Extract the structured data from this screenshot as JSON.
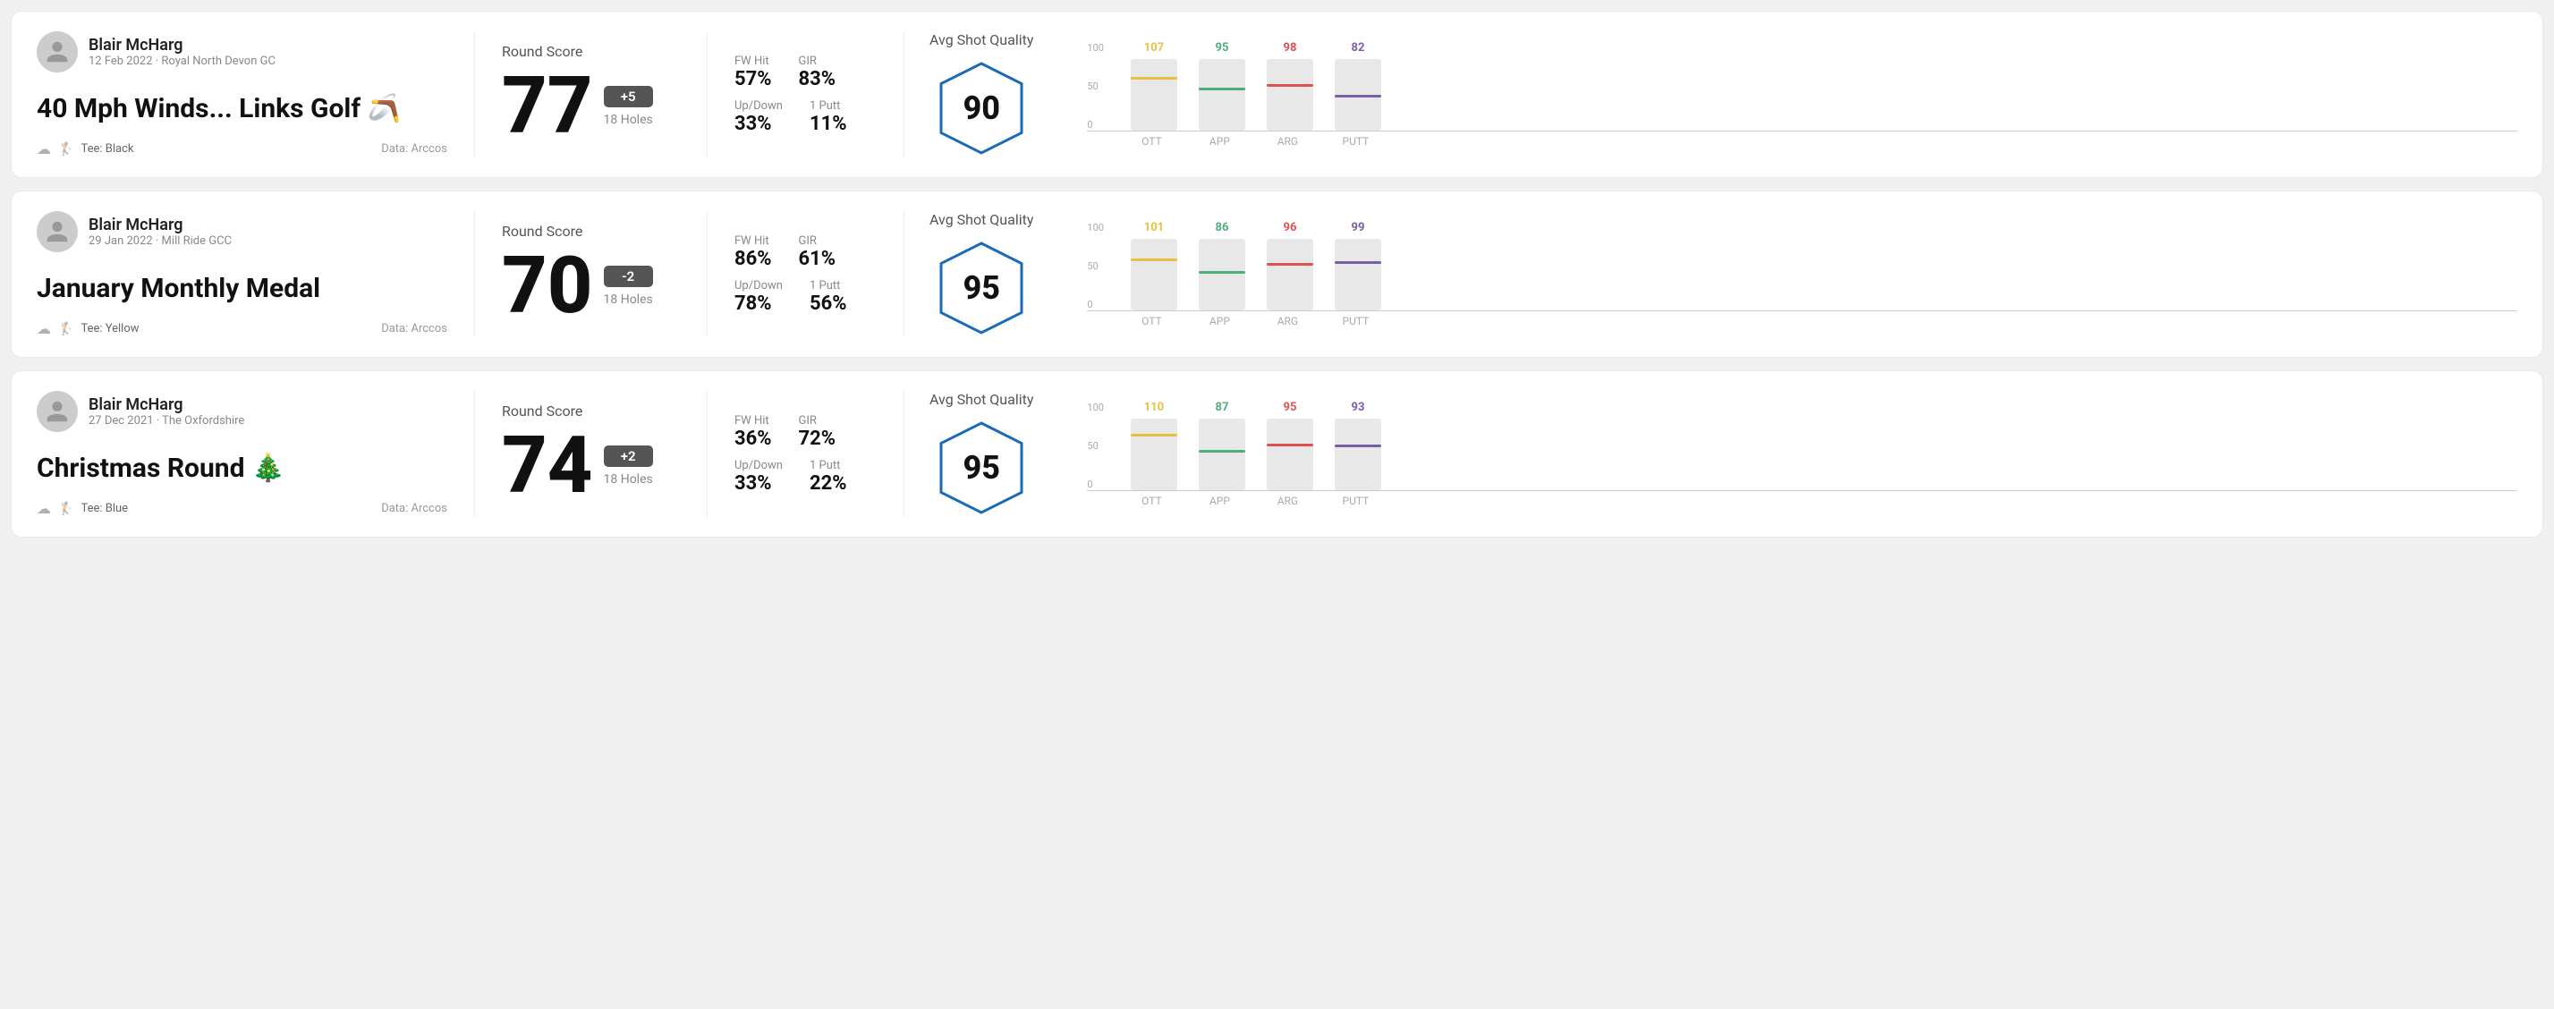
{
  "rounds": [
    {
      "id": "round1",
      "user": {
        "name": "Blair McHarg",
        "meta": "12 Feb 2022 · Royal North Devon GC"
      },
      "title": "40 Mph Winds... Links Golf 🪃",
      "tee": "Black",
      "data_source": "Data: Arccos",
      "score": {
        "value": "77",
        "badge": "+5",
        "holes": "18 Holes"
      },
      "stats": [
        {
          "label": "FW Hit",
          "value": "57%"
        },
        {
          "label": "GIR",
          "value": "83%"
        },
        {
          "label": "Up/Down",
          "value": "33%"
        },
        {
          "label": "1 Putt",
          "value": "11%"
        }
      ],
      "quality": {
        "label": "Avg Shot Quality",
        "score": "90"
      },
      "chart": {
        "bars": [
          {
            "label": "OTT",
            "value": 107,
            "color": "#e8c040",
            "pct": 75
          },
          {
            "label": "APP",
            "value": 95,
            "color": "#4caf78",
            "pct": 60
          },
          {
            "label": "ARG",
            "value": 98,
            "color": "#e05050",
            "pct": 65
          },
          {
            "label": "PUTT",
            "value": 82,
            "color": "#7b5ea7",
            "pct": 50
          }
        ]
      }
    },
    {
      "id": "round2",
      "user": {
        "name": "Blair McHarg",
        "meta": "29 Jan 2022 · Mill Ride GCC"
      },
      "title": "January Monthly Medal",
      "tee": "Yellow",
      "data_source": "Data: Arccos",
      "score": {
        "value": "70",
        "badge": "-2",
        "holes": "18 Holes"
      },
      "stats": [
        {
          "label": "FW Hit",
          "value": "86%"
        },
        {
          "label": "GIR",
          "value": "61%"
        },
        {
          "label": "Up/Down",
          "value": "78%"
        },
        {
          "label": "1 Putt",
          "value": "56%"
        }
      ],
      "quality": {
        "label": "Avg Shot Quality",
        "score": "95"
      },
      "chart": {
        "bars": [
          {
            "label": "OTT",
            "value": 101,
            "color": "#e8c040",
            "pct": 72
          },
          {
            "label": "APP",
            "value": 86,
            "color": "#4caf78",
            "pct": 55
          },
          {
            "label": "ARG",
            "value": 96,
            "color": "#e05050",
            "pct": 66
          },
          {
            "label": "PUTT",
            "value": 99,
            "color": "#7b5ea7",
            "pct": 68
          }
        ]
      }
    },
    {
      "id": "round3",
      "user": {
        "name": "Blair McHarg",
        "meta": "27 Dec 2021 · The Oxfordshire"
      },
      "title": "Christmas Round 🎄",
      "tee": "Blue",
      "data_source": "Data: Arccos",
      "score": {
        "value": "74",
        "badge": "+2",
        "holes": "18 Holes"
      },
      "stats": [
        {
          "label": "FW Hit",
          "value": "36%"
        },
        {
          "label": "GIR",
          "value": "72%"
        },
        {
          "label": "Up/Down",
          "value": "33%"
        },
        {
          "label": "1 Putt",
          "value": "22%"
        }
      ],
      "quality": {
        "label": "Avg Shot Quality",
        "score": "95"
      },
      "chart": {
        "bars": [
          {
            "label": "OTT",
            "value": 110,
            "color": "#e8c040",
            "pct": 78
          },
          {
            "label": "APP",
            "value": 87,
            "color": "#4caf78",
            "pct": 56
          },
          {
            "label": "ARG",
            "value": 95,
            "color": "#e05050",
            "pct": 65
          },
          {
            "label": "PUTT",
            "value": 93,
            "color": "#7b5ea7",
            "pct": 63
          }
        ]
      }
    }
  ],
  "y_axis_labels": [
    "100",
    "50",
    "0"
  ]
}
